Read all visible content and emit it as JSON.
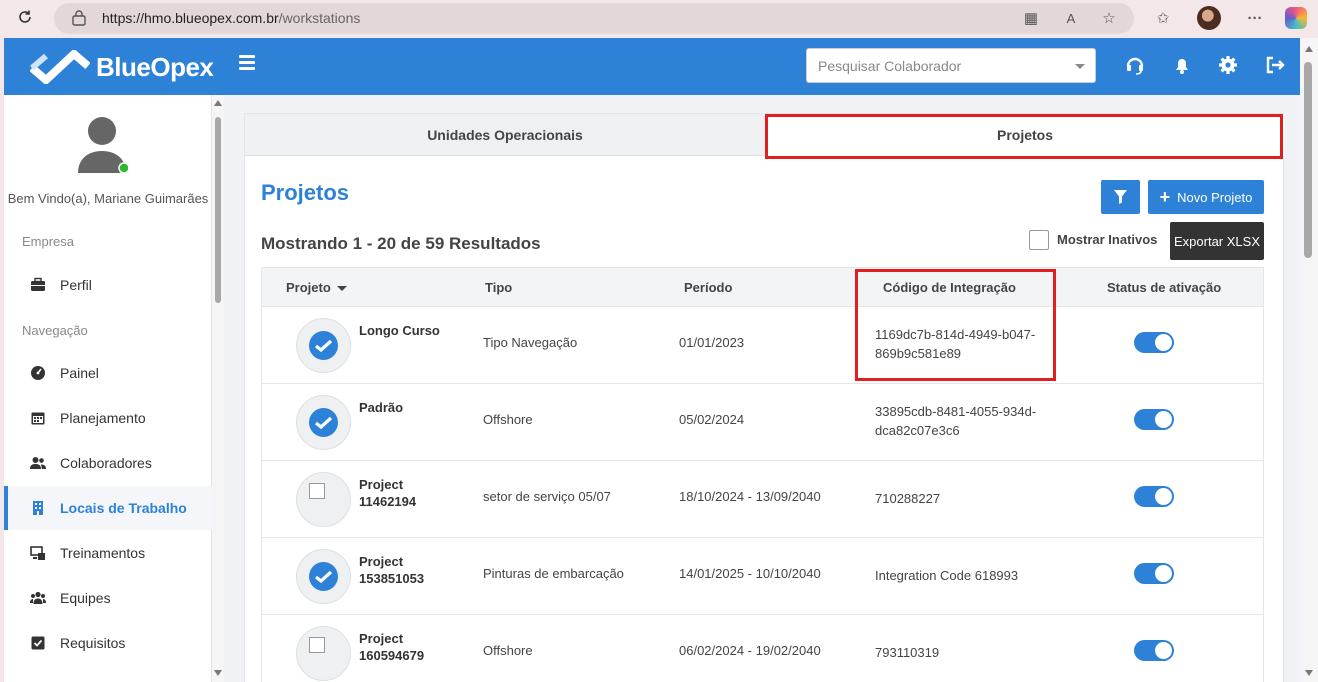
{
  "browser": {
    "url_host": "https://hmo.blueopex.com.br",
    "url_path": "/workstations"
  },
  "header": {
    "brand": "BlueOpex",
    "search_placeholder": "Pesquisar Colaborador"
  },
  "sidebar": {
    "welcome": "Bem Vindo(a), Mariane Guimarães",
    "section_empresa": "Empresa",
    "section_navegacao": "Navegação",
    "items": [
      {
        "label": "Perfil",
        "icon": "briefcase-icon"
      },
      {
        "label": "Painel",
        "icon": "dashboard-icon"
      },
      {
        "label": "Planejamento",
        "icon": "calendar-icon"
      },
      {
        "label": "Colaboradores",
        "icon": "users-icon"
      },
      {
        "label": "Locais de Trabalho",
        "icon": "building-icon",
        "active": true
      },
      {
        "label": "Treinamentos",
        "icon": "training-icon"
      },
      {
        "label": "Equipes",
        "icon": "team-icon"
      },
      {
        "label": "Requisitos",
        "icon": "checkbox-icon"
      }
    ]
  },
  "tabs": {
    "operational_units": "Unidades Operacionais",
    "projects": "Projetos"
  },
  "main": {
    "title": "Projetos",
    "new_project": "Novo Projeto",
    "results": "Mostrando 1 - 20 de 59 Resultados",
    "show_inactive": "Mostrar Inativos",
    "export": "Exportar XLSX"
  },
  "table": {
    "columns": {
      "project": "Projeto",
      "type": "Tipo",
      "period": "Período",
      "integration_code": "Código de Integração",
      "status": "Status de ativação"
    },
    "rows": [
      {
        "name": "Longo Curso",
        "type": "Tipo Navegação",
        "period": "01/01/2023",
        "code": "1169dc7b-814d-4949-b047-869b9c581e89",
        "logo": "checkmark",
        "active": true
      },
      {
        "name": "Padrão",
        "type": "Offshore",
        "period": "05/02/2024",
        "code": "33895cdb-8481-4055-934d-dca82c07e3c6",
        "logo": "checkmark",
        "active": true
      },
      {
        "name": "Project 11462194",
        "type": "setor de serviço 05/07",
        "period": "18/10/2024 - 13/09/2040",
        "code": "710288227",
        "logo": "broken",
        "active": true
      },
      {
        "name": "Project 153851053",
        "type": "Pinturas de embarcação",
        "period": "14/01/2025 - 10/10/2040",
        "code": "Integration Code 618993",
        "logo": "checkmark",
        "active": true
      },
      {
        "name": "Project 160594679",
        "type": "Offshore",
        "period": "06/02/2024 - 19/02/2040",
        "code": "793110319",
        "logo": "broken",
        "active": true
      }
    ]
  },
  "colors": {
    "brand_blue": "#2d82d8",
    "highlight_red": "#e02020",
    "export_dark": "#333333"
  }
}
